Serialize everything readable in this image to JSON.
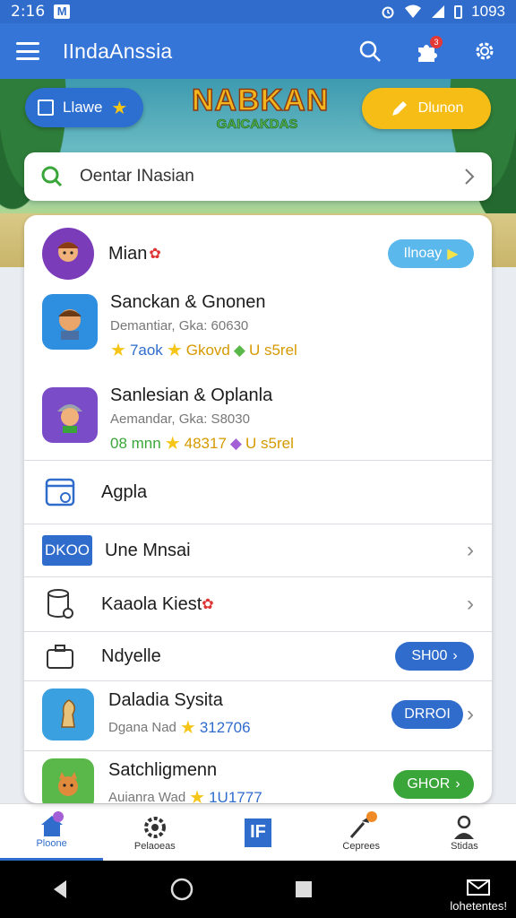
{
  "status_bar": {
    "time": "2:16",
    "notif_icon": "M",
    "right_text": "1093"
  },
  "app_bar": {
    "title": "IIndaAnssia"
  },
  "hero": {
    "left_button_label": "Llawe",
    "logo_line1": "NABKAN",
    "logo_line2": "GAICAKDAS",
    "right_button_label": "Dlunon"
  },
  "search": {
    "placeholder": "Oentar INasian"
  },
  "list": {
    "header_row": {
      "title": "Mian",
      "pill": "Ilnoay"
    },
    "game1": {
      "title": "Sanckan & Gnonen",
      "subtitle": "Demantiar, Gka: 60630",
      "meta": [
        "7aok",
        "Gkovd",
        "U s5rel"
      ]
    },
    "game2": {
      "title": "Sanlesian & Oplanla",
      "subtitle": "Aemandar, Gka: S8030",
      "meta": [
        "08 mnn",
        "48317",
        "U s5rel"
      ]
    },
    "agpla": {
      "title": "Agpla"
    },
    "une": {
      "badge": "DKOO",
      "title": "Une Mnsai"
    },
    "kaaola": {
      "title": "Kaaola Kiest"
    },
    "nayelle": {
      "title": "Ndyelle",
      "pill": "SH00"
    },
    "dalada": {
      "title": "Daladia Sysita",
      "subtitle": "Dgana Nad",
      "meta": "312706",
      "pill": "DRROI"
    },
    "satch": {
      "title": "Satchligmenn",
      "subtitle": "Auianra Wad",
      "meta": "1U1777",
      "pill": "GHOR"
    }
  },
  "bottom_nav": [
    "Ploone",
    "Pelaoeas",
    "IF",
    "Ceprees",
    "Stidas"
  ],
  "system_nav": {
    "right_text": "lohetentes!"
  },
  "colors": {
    "primary": "#3575d8",
    "accent_yellow": "#f6bd16",
    "green": "#3aa63a"
  }
}
